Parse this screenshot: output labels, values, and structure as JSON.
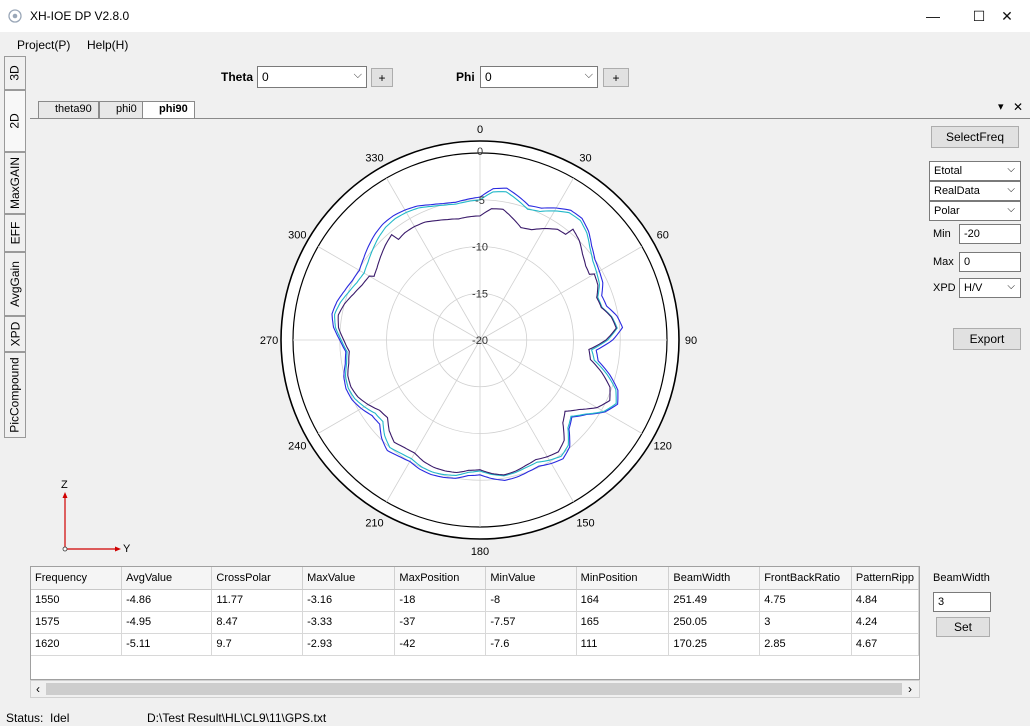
{
  "window": {
    "title": "XH-IOE DP V2.8.0",
    "minimize": "—",
    "maximize": "☐",
    "close": "✕"
  },
  "menu": [
    "Project(P)",
    "Help(H)"
  ],
  "side_tabs": [
    "3D",
    "2D",
    "MaxGAIN",
    "EFF",
    "AvgGain",
    "XPD",
    "PicCompound"
  ],
  "toolbar": {
    "theta_label": "Theta",
    "theta_value": "0",
    "phi_label": "Phi",
    "phi_value": "0",
    "add_label": "+"
  },
  "doc_tabs": [
    "theta90",
    "phi0",
    "phi90"
  ],
  "doc_tab_controls": {
    "menu": "▾",
    "close": "✕"
  },
  "polar": {
    "angles": [
      "0",
      "30",
      "60",
      "90",
      "120",
      "150",
      "180",
      "210",
      "240",
      "270",
      "300",
      "330"
    ],
    "ring_labels": [
      "0",
      "-5",
      "-10",
      "-15",
      "-20"
    ],
    "range": [
      -20,
      0
    ],
    "series_colors": [
      "#2a2ae0",
      "#22b8c8",
      "#3a1a6a"
    ],
    "axis_z": "Z",
    "axis_y": "Y"
  },
  "controls": {
    "select_freq": "SelectFreq",
    "field": "Etotal",
    "data": "RealData",
    "plot": "Polar",
    "min_label": "Min",
    "min_value": "-20",
    "max_label": "Max",
    "max_value": "0",
    "xpd_label": "XPD",
    "xpd_value": "H/V",
    "export": "Export",
    "beamwidth_label": "BeamWidth",
    "beamwidth_value": "3",
    "set": "Set"
  },
  "table": {
    "headers": [
      "Frequency",
      "AvgValue",
      "CrossPolar",
      "MaxValue",
      "MaxPosition",
      "MinValue",
      "MinPosition",
      "BeamWidth",
      "FrontBackRatio",
      "PatternRipp"
    ],
    "rows": [
      [
        "1550",
        "-4.86",
        "11.77",
        "-3.16",
        "-18",
        "-8",
        "164",
        "251.49",
        "4.75",
        "4.84"
      ],
      [
        "1575",
        "-4.95",
        "8.47",
        "-3.33",
        "-37",
        "-7.57",
        "165",
        "250.05",
        "3",
        "4.24"
      ],
      [
        "1620",
        "-5.11",
        "9.7",
        "-2.93",
        "-42",
        "-7.6",
        "111",
        "170.25",
        "2.85",
        "4.67"
      ]
    ]
  },
  "scroll": {
    "left": "‹",
    "right": "›"
  },
  "status": {
    "label": "Status:  Idel",
    "path": "D:\\Test Result\\HL\\CL9\\11\\GPS.txt"
  }
}
